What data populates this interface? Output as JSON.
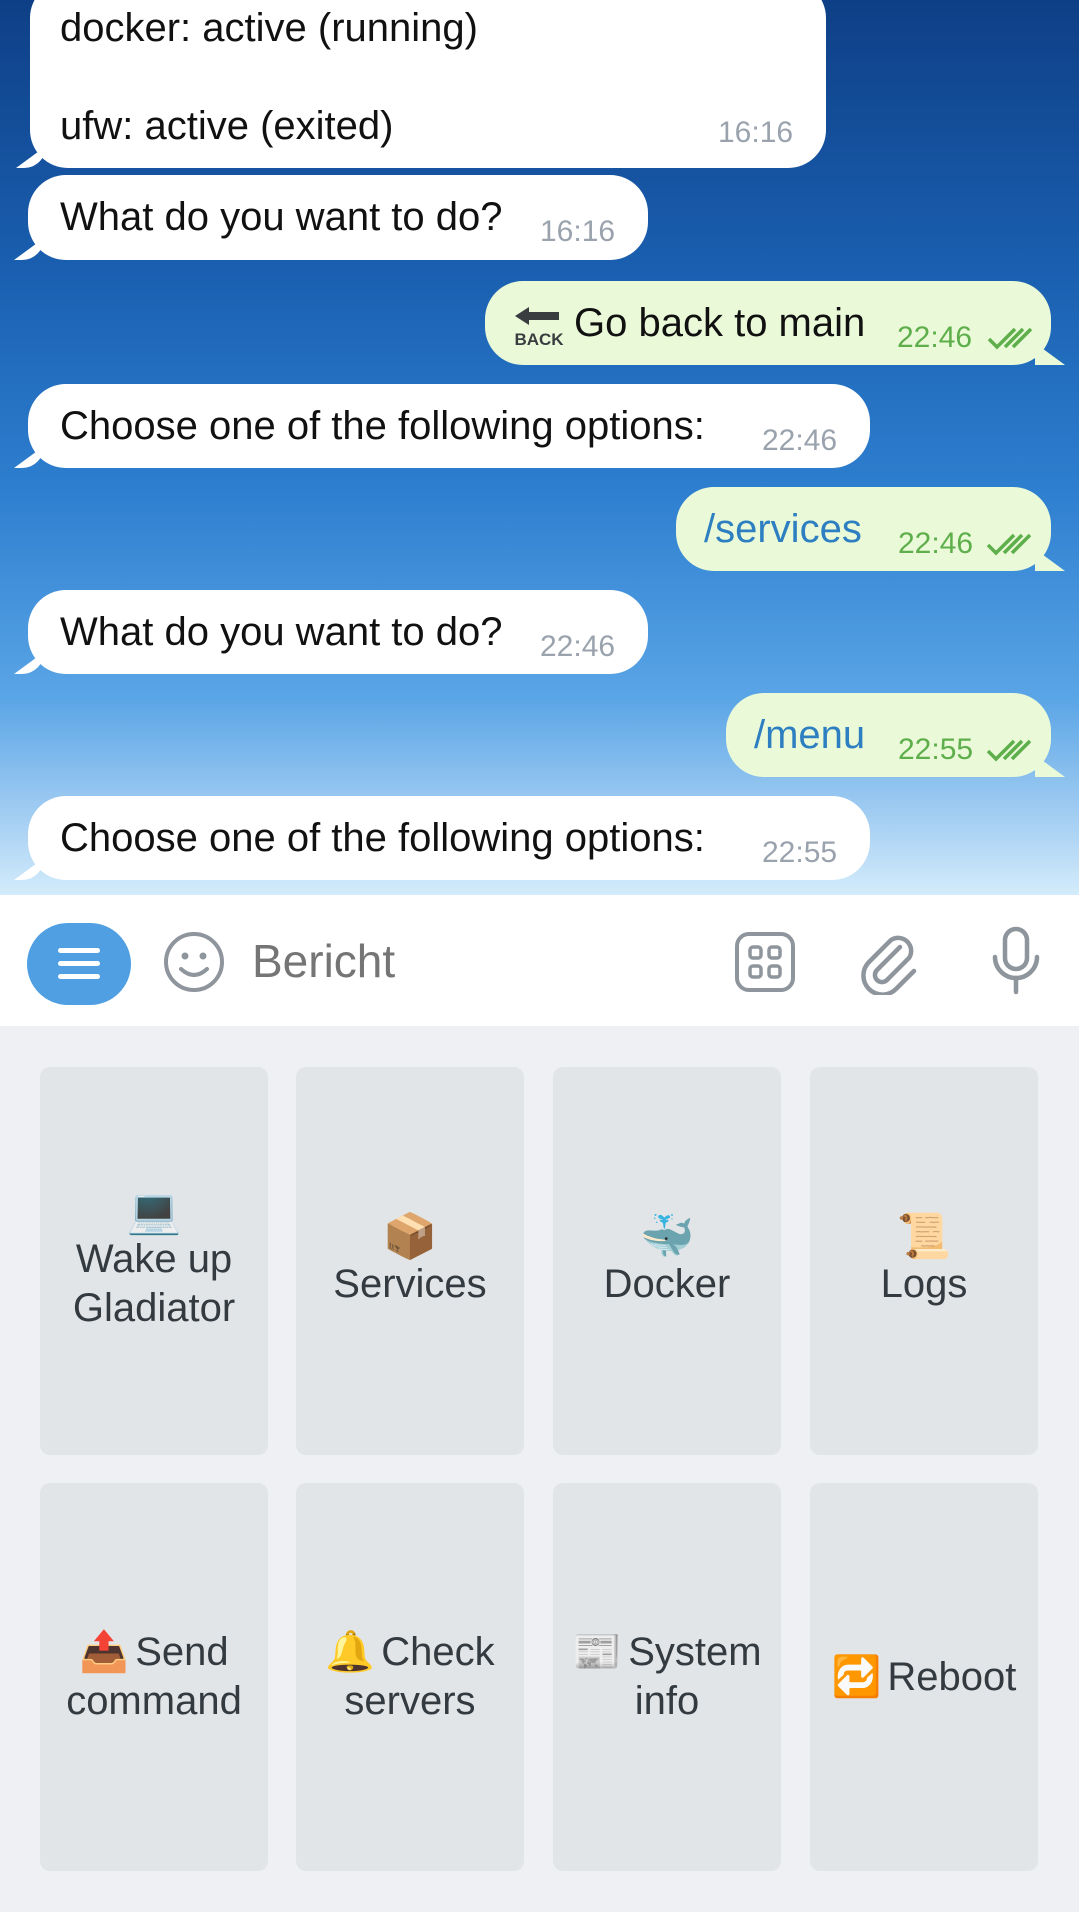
{
  "messages": [
    {
      "dir": "in",
      "lines": [
        "docker: active (running)",
        "ufw: active (exited)"
      ],
      "time": "16:16"
    },
    {
      "dir": "in",
      "text": "What do you want to do?",
      "time": "16:16"
    },
    {
      "dir": "out",
      "badge": "BACK",
      "text": "Go back to main",
      "time": "22:46"
    },
    {
      "dir": "in",
      "text": "Choose one of the following options:",
      "time": "22:46"
    },
    {
      "dir": "out",
      "text": "/services",
      "time": "22:46"
    },
    {
      "dir": "in",
      "text": "What do you want to do?",
      "time": "22:46"
    },
    {
      "dir": "out",
      "text": "/menu",
      "time": "22:55"
    },
    {
      "dir": "in",
      "text": "Choose one of the following options:",
      "time": "22:55"
    }
  ],
  "input": {
    "placeholder": "Bericht"
  },
  "icons": {
    "menu": "menu-icon",
    "emoji": "smiley-icon",
    "stickers": "sticker-grid-icon",
    "attach": "paperclip-icon",
    "mic": "microphone-icon",
    "back": "back-arrow-icon",
    "ticks": "double-check-icon"
  },
  "keyboard": {
    "row1": [
      {
        "emoji": "💻",
        "label_l1": "Wake up",
        "label_l2": "Gladiator"
      },
      {
        "emoji": "📦",
        "label_l1": "Services"
      },
      {
        "emoji": "🐳",
        "label_l1": "Docker"
      },
      {
        "emoji": "📜",
        "label_l1": "Logs"
      }
    ],
    "row2": [
      {
        "emoji": "📤",
        "label_l1": "Send",
        "label_l2": "command"
      },
      {
        "emoji": "🔔",
        "label_l1": "Check",
        "label_l2": "servers"
      },
      {
        "emoji": "📰",
        "label_l1": "System",
        "label_l2": "info"
      },
      {
        "emoji": "🔁",
        "label_l1": "Reboot"
      }
    ]
  },
  "colors": {
    "accent": "#4f9fe2",
    "outgoing_bubble": "#eafad8",
    "command_text": "#2d7fc1",
    "outgoing_time": "#5fae4c"
  }
}
